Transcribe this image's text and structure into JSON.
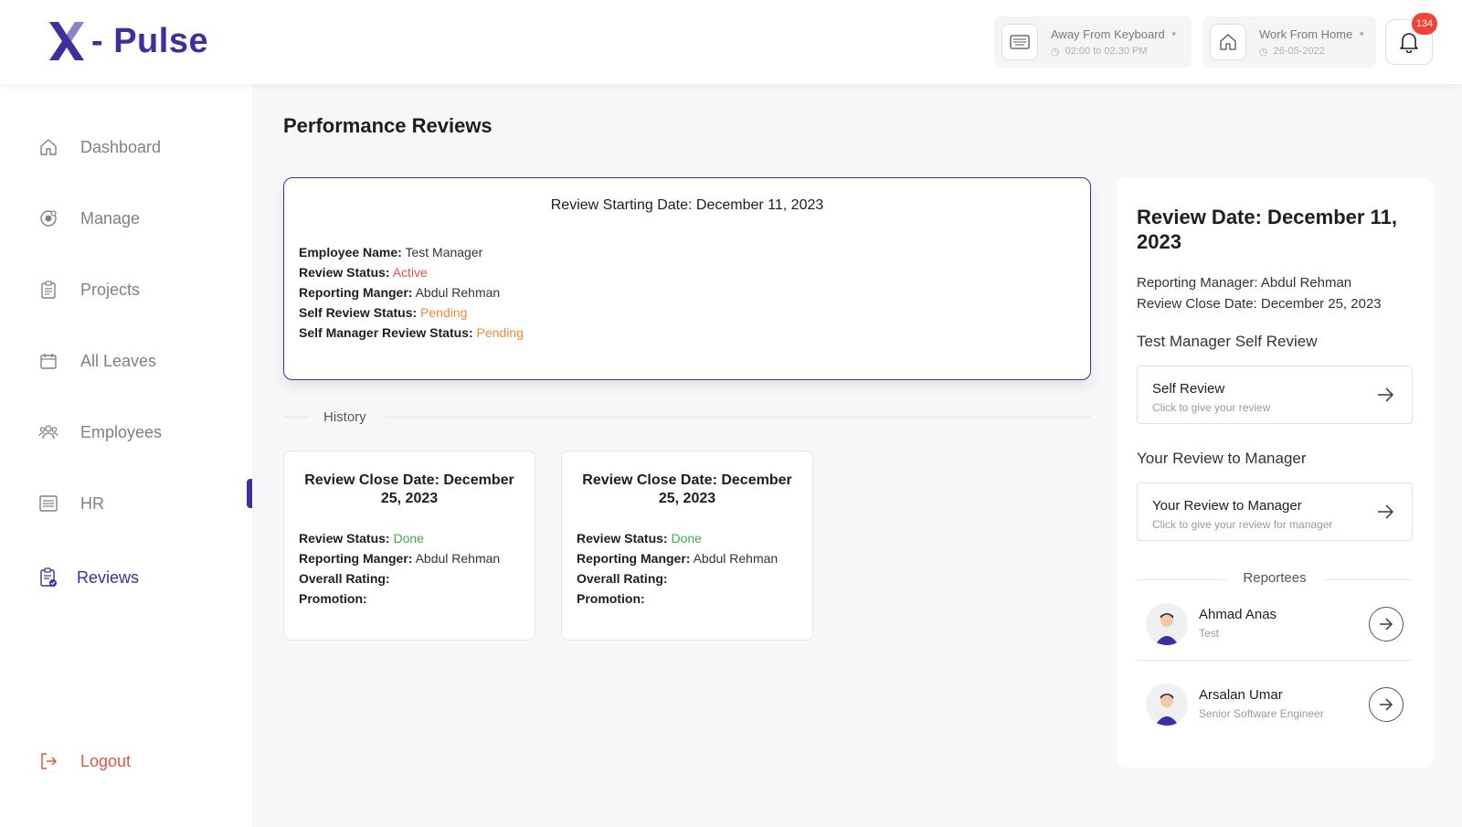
{
  "header": {
    "logo_text": "- Pulse",
    "status": {
      "title": "Away From Keyboard",
      "time": "02:00 to 02:30 PM"
    },
    "location": {
      "title": "Work From Home",
      "date": "26-05-2022"
    },
    "notifications_count": "134"
  },
  "sidebar": {
    "items": [
      {
        "label": "Dashboard",
        "icon": "home-icon"
      },
      {
        "label": "Manage",
        "icon": "target-icon"
      },
      {
        "label": "Projects",
        "icon": "clipboard-icon"
      },
      {
        "label": "All Leaves",
        "icon": "calendar-icon"
      },
      {
        "label": "Employees",
        "icon": "people-icon"
      },
      {
        "label": "HR",
        "icon": "list-icon"
      },
      {
        "label": "Reviews",
        "icon": "clipboard-check-icon",
        "active": true
      }
    ],
    "logout_label": "Logout"
  },
  "main": {
    "title": "Performance Reviews",
    "current": {
      "title": "Review Starting Date: December 11, 2023",
      "employee_label": "Employee Name:",
      "employee": "Test Manager",
      "status_label": "Review Status:",
      "status": "Active",
      "manager_label": "Reporting Manger:",
      "manager": "Abdul Rehman",
      "self_label": "Self Review Status:",
      "self_status": "Pending",
      "self_manager_label": "Self Manager Review Status:",
      "self_manager_status": "Pending"
    },
    "history_label": "History",
    "history": [
      {
        "title": "Review Close Date: December 25, 2023",
        "status_label": "Review Status:",
        "status": "Done",
        "manager_label": "Reporting Manger:",
        "manager": "Abdul Rehman",
        "rating_label": "Overall Rating:",
        "promotion_label": "Promotion:"
      },
      {
        "title": "Review Close Date: December 25, 2023",
        "status_label": "Review Status:",
        "status": "Done",
        "manager_label": "Reporting Manger:",
        "manager": "Abdul Rehman",
        "rating_label": "Overall Rating:",
        "promotion_label": "Promotion:"
      }
    ]
  },
  "panel": {
    "title": "Review Date: December 11, 2023",
    "manager_line": "Reporting Manager: Abdul Rehman",
    "close_line": "Review Close Date: December 25, 2023",
    "self_section": "Test Manager Self Review",
    "self_action": {
      "title": "Self Review",
      "sub": "Click to give your review"
    },
    "manager_section": "Your Review to Manager",
    "manager_action": {
      "title": "Your Review to Manager",
      "sub": "Click to give your review for manager"
    },
    "reportees_label": "Reportees",
    "reportees": [
      {
        "name": "Ahmad Anas",
        "role": "Test"
      },
      {
        "name": "Arsalan Umar",
        "role": "Senior Software Engineer"
      }
    ]
  },
  "colors": {
    "brand": "#3d2f9e",
    "active": "#e05545",
    "pending": "#f28a3a",
    "done": "#3fae49"
  }
}
